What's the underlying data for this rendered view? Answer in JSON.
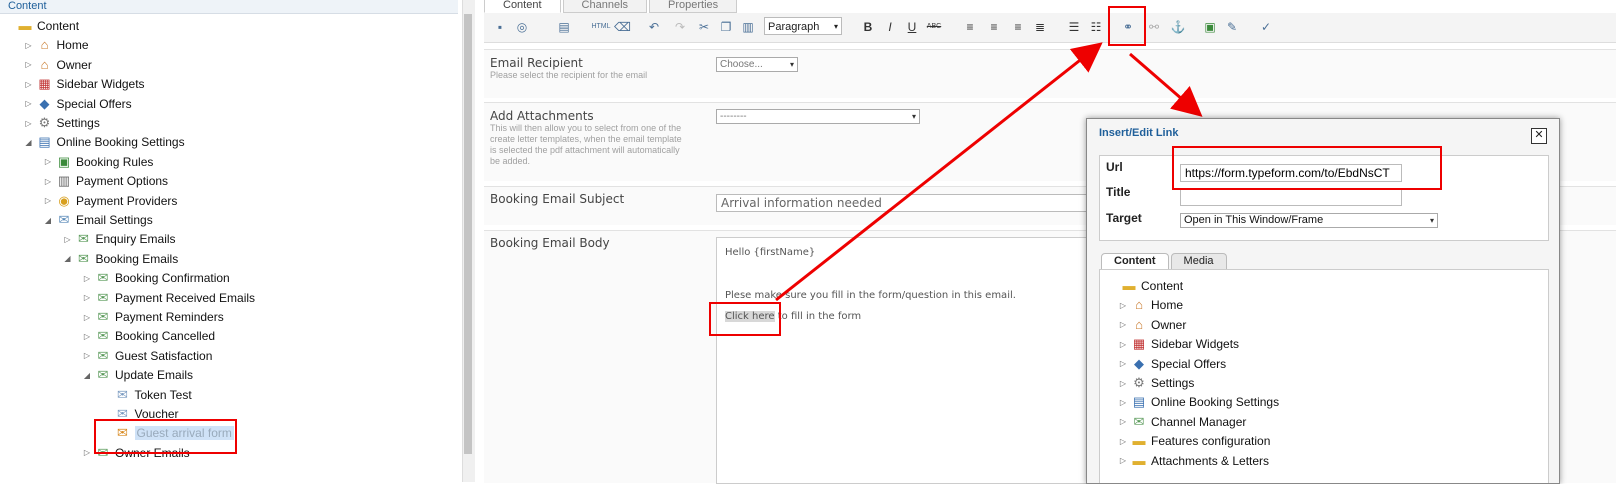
{
  "left_panel": {
    "title": "Content",
    "tree": [
      {
        "label": "Content",
        "icon": "folder-icon",
        "toggle": "",
        "level": 0
      },
      {
        "label": "Home",
        "icon": "home-icon",
        "toggle": "▷",
        "level": 1
      },
      {
        "label": "Owner",
        "icon": "home-icon",
        "toggle": "▷",
        "level": 1
      },
      {
        "label": "Sidebar Widgets",
        "icon": "blocks-icon",
        "toggle": "▷",
        "level": 1
      },
      {
        "label": "Special Offers",
        "icon": "python-icon",
        "toggle": "▷",
        "level": 1
      },
      {
        "label": "Settings",
        "icon": "gear-icon",
        "toggle": "▷",
        "level": 1
      },
      {
        "label": "Online Booking Settings",
        "icon": "settings-doc-icon",
        "toggle": "◢",
        "level": 1
      },
      {
        "label": "Booking Rules",
        "icon": "rules-icon",
        "toggle": "▷",
        "level": 2
      },
      {
        "label": "Payment Options",
        "icon": "building-icon",
        "toggle": "▷",
        "level": 2
      },
      {
        "label": "Payment Providers",
        "icon": "coins-icon",
        "toggle": "▷",
        "level": 2
      },
      {
        "label": "Email Settings",
        "icon": "email-settings-icon",
        "toggle": "◢",
        "level": 2
      },
      {
        "label": "Enquiry Emails",
        "icon": "email-icon",
        "toggle": "▷",
        "level": 3
      },
      {
        "label": "Booking Emails",
        "icon": "email-icon",
        "toggle": "◢",
        "level": 3
      },
      {
        "label": "Booking Confirmation",
        "icon": "email-icon",
        "toggle": "▷",
        "level": 4
      },
      {
        "label": "Payment Received Emails",
        "icon": "email-icon",
        "toggle": "▷",
        "level": 4
      },
      {
        "label": "Payment Reminders",
        "icon": "email-icon",
        "toggle": "▷",
        "level": 4
      },
      {
        "label": "Booking Cancelled",
        "icon": "email-icon",
        "toggle": "▷",
        "level": 4
      },
      {
        "label": "Guest Satisfaction",
        "icon": "email-icon",
        "toggle": "▷",
        "level": 4
      },
      {
        "label": "Update Emails",
        "icon": "email-icon",
        "toggle": "◢",
        "level": 4
      },
      {
        "label": "Token Test",
        "icon": "envelope-icon",
        "toggle": "",
        "level": 5
      },
      {
        "label": "Voucher",
        "icon": "envelope-icon",
        "toggle": "",
        "level": 5
      },
      {
        "label": "Guest arrival form",
        "icon": "new-envelope-icon",
        "toggle": "",
        "level": 5,
        "selected": true
      },
      {
        "label": "Owner Emails",
        "icon": "email-icon",
        "toggle": "▷",
        "level": 4
      }
    ]
  },
  "tabs": [
    "Content",
    "Channels",
    "Properties"
  ],
  "toolbar": {
    "format_select": "Paragraph",
    "html_label": "HTML"
  },
  "fields": {
    "recipient": {
      "label": "Email Recipient",
      "desc": "Please select the recipient for the email",
      "value": "Choose..."
    },
    "attachments": {
      "label": "Add Attachments",
      "desc": "This will then allow you to select from one of the create letter templates, when the email template is selected the pdf attachment will automatically be added.",
      "value": "--------"
    },
    "subject": {
      "label": "Booking Email Subject",
      "value": "Arrival information needed"
    },
    "body": {
      "label": "Booking Email Body",
      "line1": "Hello {firstName}",
      "line2": "Plese make sure you fill in the form/question in this email.",
      "link_text": "Click here",
      "line3_rest": " to fill in the form"
    }
  },
  "dialog": {
    "title": "Insert/Edit Link",
    "close": "✕",
    "url_label": "Url",
    "url_value": "https://form.typeform.com/to/EbdNsCT",
    "title_label": "Title",
    "title_value": "",
    "target_label": "Target",
    "target_value": "Open in This Window/Frame",
    "tabs": [
      "Content",
      "Media"
    ],
    "tree": [
      {
        "label": "Content",
        "icon": "folder-icon",
        "toggle": "",
        "level": 0
      },
      {
        "label": "Home",
        "icon": "home-icon",
        "toggle": "▷",
        "level": 1
      },
      {
        "label": "Owner",
        "icon": "home-icon",
        "toggle": "▷",
        "level": 1
      },
      {
        "label": "Sidebar Widgets",
        "icon": "blocks-icon",
        "toggle": "▷",
        "level": 1
      },
      {
        "label": "Special Offers",
        "icon": "python-icon",
        "toggle": "▷",
        "level": 1
      },
      {
        "label": "Settings",
        "icon": "gear-icon",
        "toggle": "▷",
        "level": 1
      },
      {
        "label": "Online Booking Settings",
        "icon": "settings-doc-icon",
        "toggle": "▷",
        "level": 1
      },
      {
        "label": "Channel Manager",
        "icon": "email-icon",
        "toggle": "▷",
        "level": 1
      },
      {
        "label": "Features configuration",
        "icon": "folder-icon",
        "toggle": "▷",
        "level": 1
      },
      {
        "label": "Attachments & Letters",
        "icon": "folder-icon",
        "toggle": "▷",
        "level": 1
      }
    ]
  },
  "colors": {
    "accent": "#1f5f9a",
    "highlight": "#e00000",
    "selection": "#cfe2f7"
  }
}
